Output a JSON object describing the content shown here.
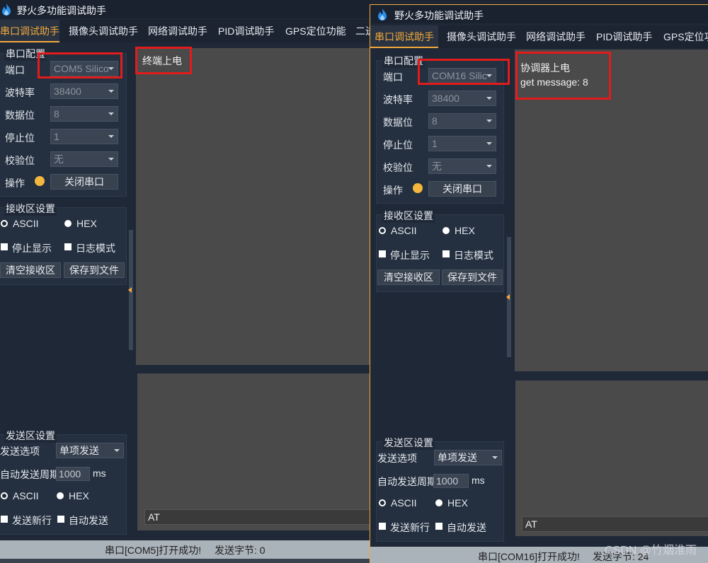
{
  "left_window": {
    "title": "野火多功能调试助手",
    "tabs": [
      "串口调试助手",
      "摄像头调试助手",
      "网络调试助手",
      "PID调试助手",
      "GPS定位功能",
      "二进"
    ],
    "serial_config": {
      "title": "串口配置",
      "port_label": "端口",
      "port_value": "COM5 Silico",
      "baud_label": "波特率",
      "baud_value": "38400",
      "data_label": "数据位",
      "data_value": "8",
      "stop_label": "停止位",
      "stop_value": "1",
      "parity_label": "校验位",
      "parity_value": "无",
      "op_label": "操作",
      "close_button": "关闭串口"
    },
    "receive": {
      "title": "接收区设置",
      "ascii": "ASCII",
      "hex": "HEX",
      "stop_display": "停止显示",
      "log_mode": "日志模式",
      "clear_button": "清空接收区",
      "save_button": "保存到文件",
      "text": "终端上电"
    },
    "send": {
      "title": "发送区设置",
      "option_label": "发送选项",
      "option_value": "单项发送",
      "period_label": "自动发送周期",
      "period_value": "1000",
      "period_unit": "ms",
      "ascii": "ASCII",
      "hex": "HEX",
      "newline": "发送新行",
      "auto_send": "自动发送",
      "input_value": "AT"
    },
    "status": {
      "message": "串口[COM5]打开成功!",
      "bytes": "发送字节: 0"
    }
  },
  "right_window": {
    "title": "野火多功能调试助手",
    "tabs": [
      "串口调试助手",
      "摄像头调试助手",
      "网络调试助手",
      "PID调试助手",
      "GPS定位功能"
    ],
    "serial_config": {
      "title": "串口配置",
      "port_label": "端口",
      "port_value": "COM16 Silic",
      "baud_label": "波特率",
      "baud_value": "38400",
      "data_label": "数据位",
      "data_value": "8",
      "stop_label": "停止位",
      "stop_value": "1",
      "parity_label": "校验位",
      "parity_value": "无",
      "op_label": "操作",
      "close_button": "关闭串口"
    },
    "receive": {
      "title": "接收区设置",
      "ascii": "ASCII",
      "hex": "HEX",
      "stop_display": "停止显示",
      "log_mode": "日志模式",
      "clear_button": "清空接收区",
      "save_button": "保存到文件",
      "line1": "协调器上电",
      "line2": "get message: 8"
    },
    "send": {
      "title": "发送区设置",
      "option_label": "发送选项",
      "option_value": "单项发送",
      "period_label": "自动发送周期",
      "period_value": "1000",
      "period_unit": "ms",
      "ascii": "ASCII",
      "hex": "HEX",
      "newline": "发送新行",
      "auto_send": "自动发送",
      "input_value": "AT"
    },
    "status": {
      "message": "串口[COM16]打开成功!",
      "bytes": "发送字节: 24"
    }
  },
  "watermark": "CSDN @竹烟淮雨",
  "colors": {
    "accent": "#f3a93c",
    "highlight_box": "#e21b1b",
    "led": "#f5b63d"
  }
}
